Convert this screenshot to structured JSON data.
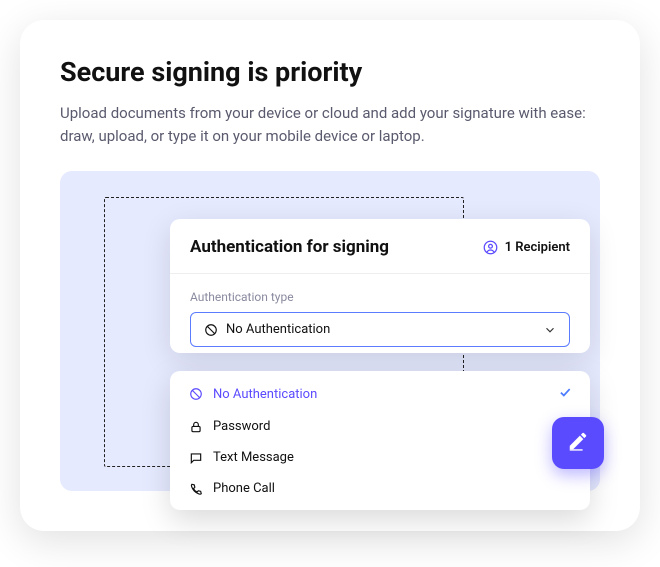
{
  "title": "Secure signing is priority",
  "subtitle": "Upload documents from your device or cloud and add your signature with ease: draw, upload, or type it on your mobile device or laptop.",
  "modal": {
    "title": "Authentication for signing",
    "recipient": "1 Recipient",
    "field_label": "Authentication type",
    "selected": "No Authentication"
  },
  "options": [
    {
      "label": "No Authentication",
      "selected": true
    },
    {
      "label": "Password"
    },
    {
      "label": "Text Message"
    },
    {
      "label": "Phone Call"
    }
  ]
}
